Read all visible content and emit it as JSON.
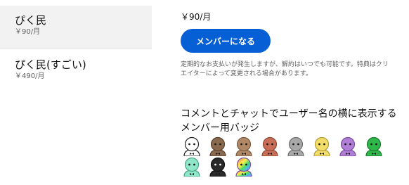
{
  "tiers": [
    {
      "name": "ぴく民",
      "price": "￥90/月",
      "selected": true
    },
    {
      "name": "ぴく民(すごい)",
      "price": "￥490/月",
      "selected": false
    }
  ],
  "details": {
    "price": "￥90/月",
    "join_button_label": "メンバーになる",
    "notice": "定期的なお支払いが発生しますが、解約はいつでも可能です。特典はクリエイターによって変更される場合があります。",
    "badge_heading": "コメントとチャットでユーザー名の横に表示するメンバー用バッジ"
  },
  "badges": [
    {
      "icon": "white-face-badge-icon",
      "face": "#ffffff",
      "ring": "#222222"
    },
    {
      "icon": "brown-face-badge-icon",
      "face": "#8a6a4e",
      "ring": "#5a4330"
    },
    {
      "icon": "tan-face-badge-icon",
      "face": "#b08866",
      "ring": "#7a5a40"
    },
    {
      "icon": "copper-face-badge-icon",
      "face": "#c96e56",
      "ring": "#8e4736"
    },
    {
      "icon": "gray-face-badge-icon",
      "face": "#a8a8a8",
      "ring": "#6e6e6e"
    },
    {
      "icon": "yellow-face-badge-icon",
      "face": "#f2dc6a",
      "ring": "#b69c30"
    },
    {
      "icon": "purple-face-badge-icon",
      "face": "#b07ed6",
      "ring": "#7a4ea0"
    },
    {
      "icon": "green-face-badge-icon",
      "face": "#2eb84a",
      "ring": "#1c7a30"
    },
    {
      "icon": "mint-face-badge-icon",
      "face": "#8fe6c8",
      "ring": "#4aa58a"
    },
    {
      "icon": "black-face-badge-icon",
      "face": "#2a2a2a",
      "ring": "#111111"
    },
    {
      "icon": "rainbow-face-badge-icon",
      "face": "rainbow",
      "ring": "#7a4ea0"
    }
  ],
  "colors": {
    "accent": "#065fd4",
    "selected_bg": "#f2f2f2",
    "secondary_text": "#606060"
  }
}
